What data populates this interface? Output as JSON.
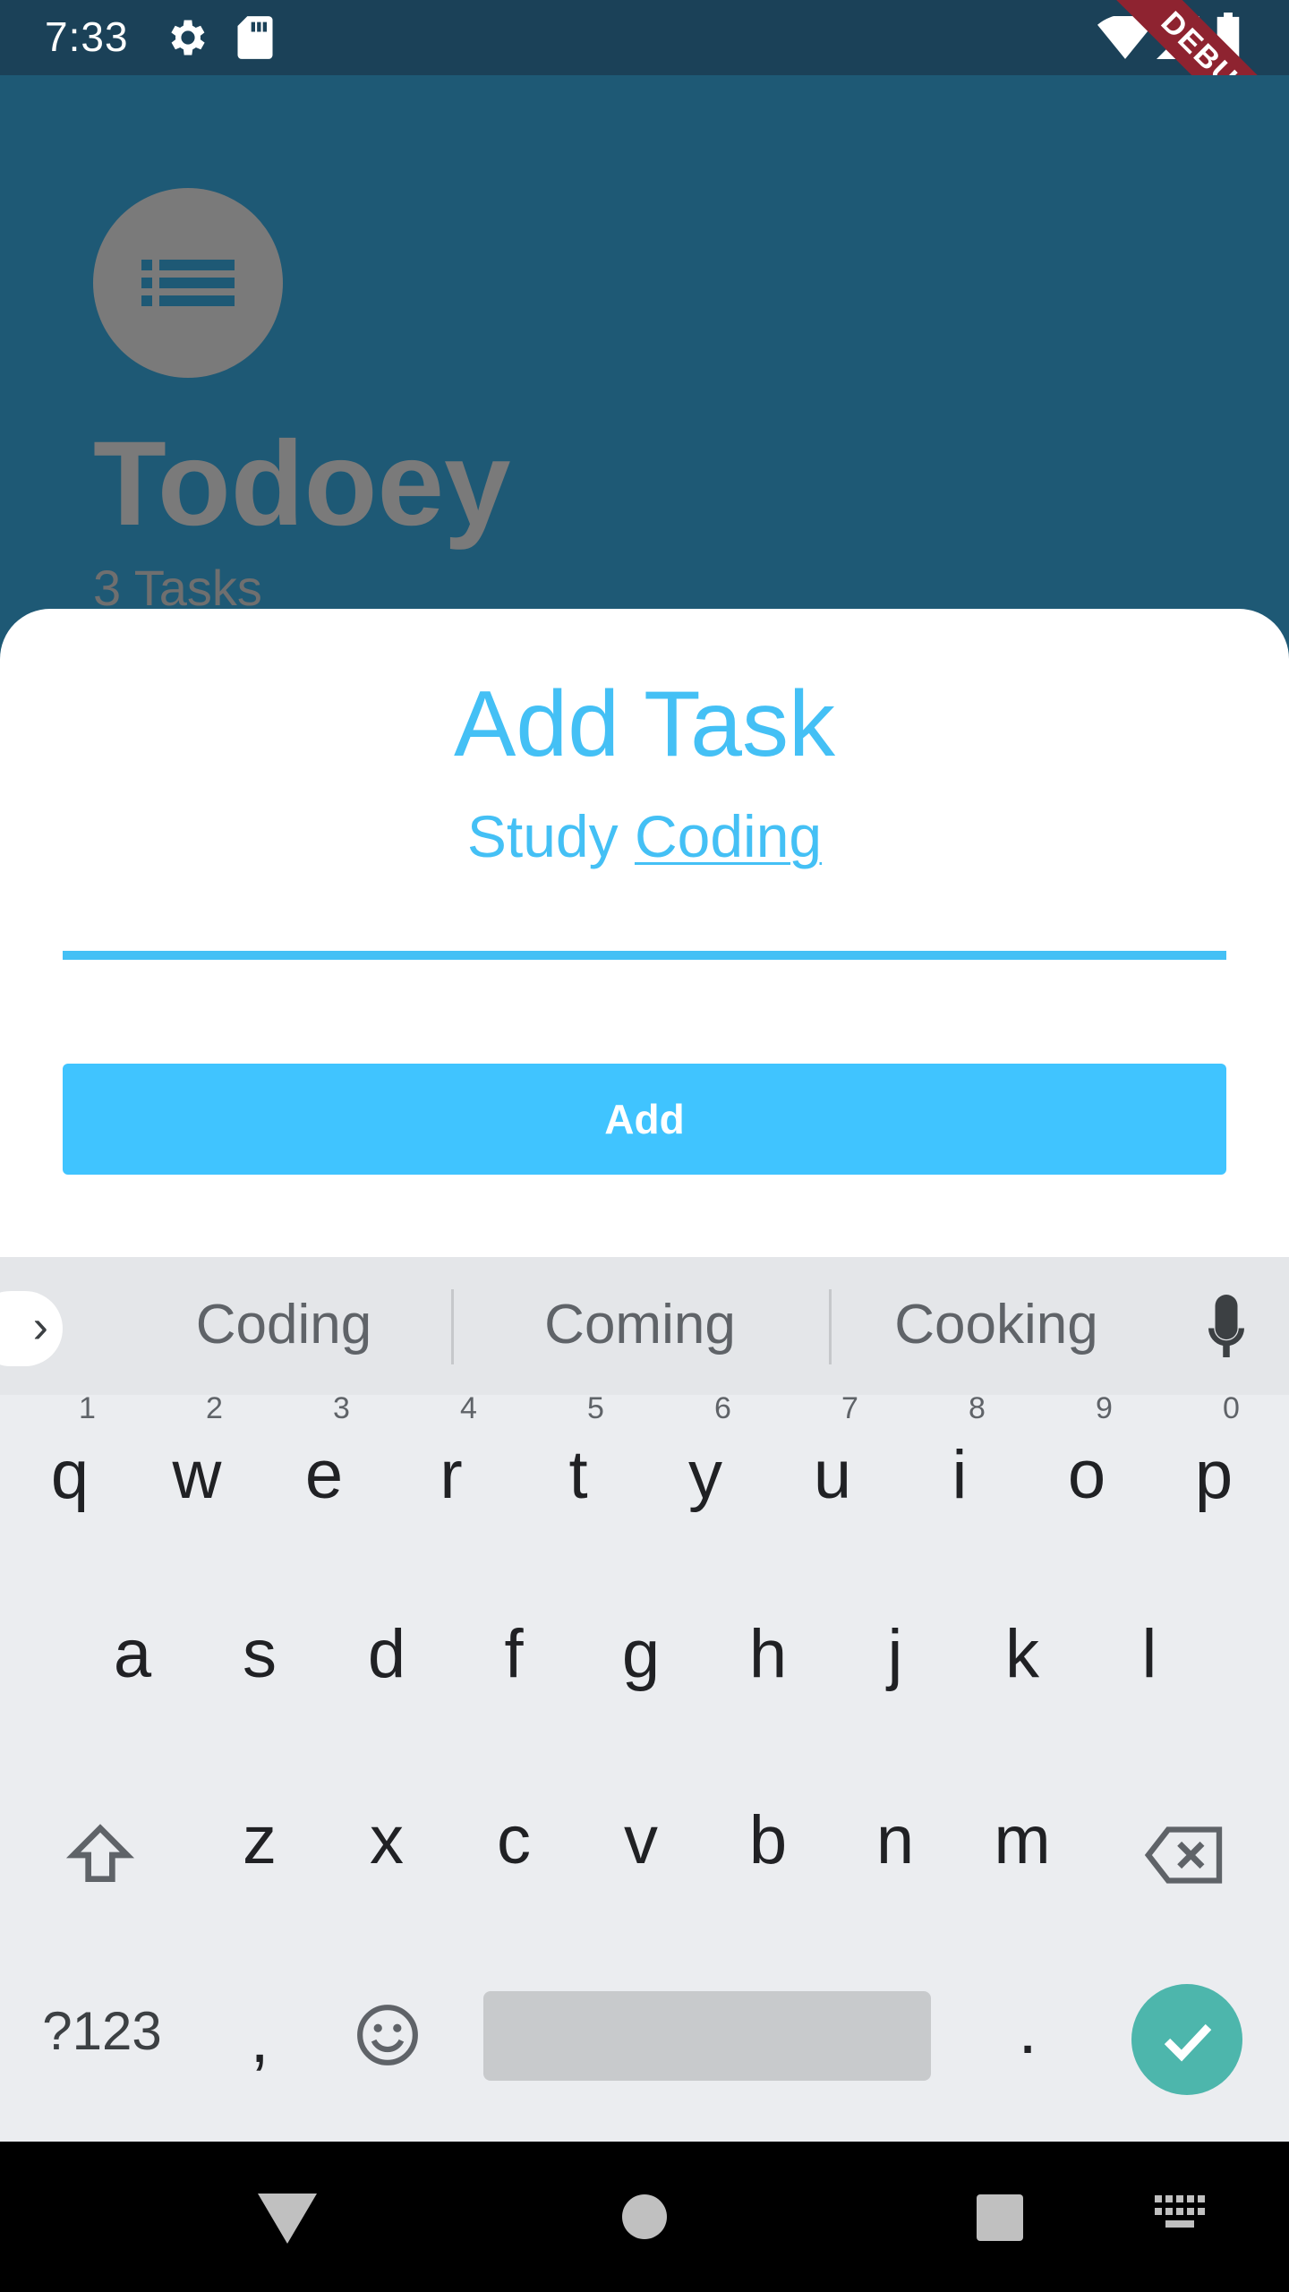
{
  "status_bar": {
    "time": "7:33",
    "debug_label": "DEBUG",
    "icons": [
      "gear-icon",
      "sd-card-icon",
      "wifi-icon",
      "signal-icon",
      "battery-icon"
    ]
  },
  "app_background": {
    "title": "Todoey",
    "task_count": "3 Tasks",
    "avatar_icon": "list-icon"
  },
  "sheet": {
    "title": "Add Task",
    "input_value_prefix": "Study ",
    "input_value_composing": "Coding",
    "add_button_label": "Add"
  },
  "keyboard": {
    "suggestions": [
      "Coding",
      "Coming",
      "Cooking"
    ],
    "row1": [
      "q",
      "w",
      "e",
      "r",
      "t",
      "y",
      "u",
      "i",
      "o",
      "p"
    ],
    "row1_hints": [
      "1",
      "2",
      "3",
      "4",
      "5",
      "6",
      "7",
      "8",
      "9",
      "0"
    ],
    "row2": [
      "a",
      "s",
      "d",
      "f",
      "g",
      "h",
      "j",
      "k",
      "l"
    ],
    "row3": [
      "z",
      "x",
      "c",
      "v",
      "b",
      "n",
      "m"
    ],
    "symbols_label": "?123",
    "comma": ",",
    "period": "."
  },
  "colors": {
    "accent": "#44c0f5",
    "button": "#40c4ff",
    "enter": "#4db6ac",
    "app_bg": "#1e5975"
  }
}
